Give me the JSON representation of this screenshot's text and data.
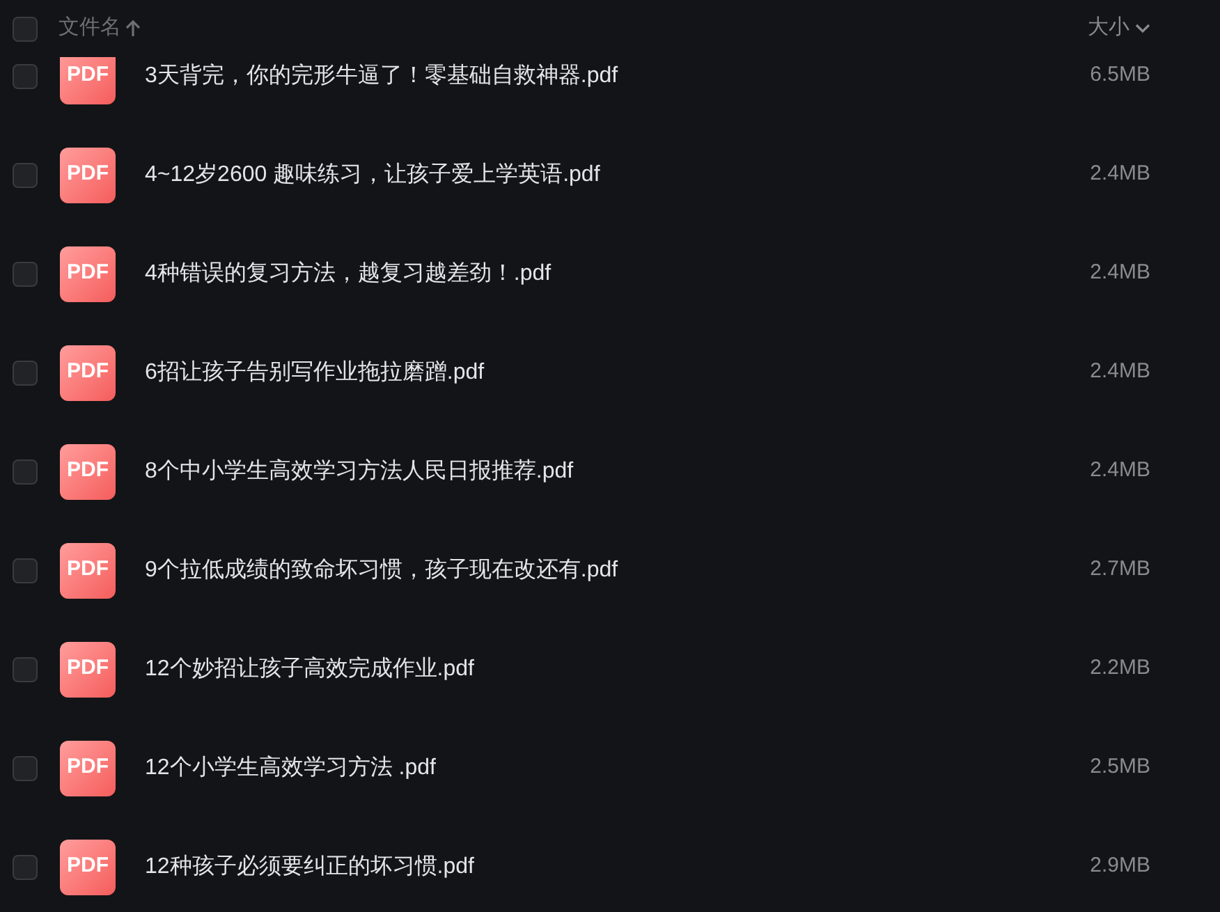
{
  "header": {
    "checked": false,
    "name_column": "文件名",
    "size_column": "大小"
  },
  "files": [
    {
      "checked": false,
      "icon_label": "PDF",
      "name": "3天背完，你的完形牛逼了！零基础自救神器.pdf",
      "size": "6.5MB"
    },
    {
      "checked": false,
      "icon_label": "PDF",
      "name": "4~12岁2600 趣味练习，让孩子爱上学英语.pdf",
      "size": "2.4MB"
    },
    {
      "checked": false,
      "icon_label": "PDF",
      "name": "4种错误的复习方法，越复习越差劲！.pdf",
      "size": "2.4MB"
    },
    {
      "checked": false,
      "icon_label": "PDF",
      "name": "6招让孩子告别写作业拖拉磨蹭.pdf",
      "size": "2.4MB"
    },
    {
      "checked": false,
      "icon_label": "PDF",
      "name": "8个中小学生高效学习方法人民日报推荐.pdf",
      "size": "2.4MB"
    },
    {
      "checked": false,
      "icon_label": "PDF",
      "name": "9个拉低成绩的致命坏习惯，孩子现在改还有.pdf",
      "size": "2.7MB"
    },
    {
      "checked": false,
      "icon_label": "PDF",
      "name": "12个妙招让孩子高效完成作业.pdf",
      "size": "2.2MB"
    },
    {
      "checked": false,
      "icon_label": "PDF",
      "name": "12个小学生高效学习方法 .pdf",
      "size": "2.5MB"
    },
    {
      "checked": false,
      "icon_label": "PDF",
      "name": "12种孩子必须要纠正的坏习惯.pdf",
      "size": "2.9MB"
    }
  ]
}
